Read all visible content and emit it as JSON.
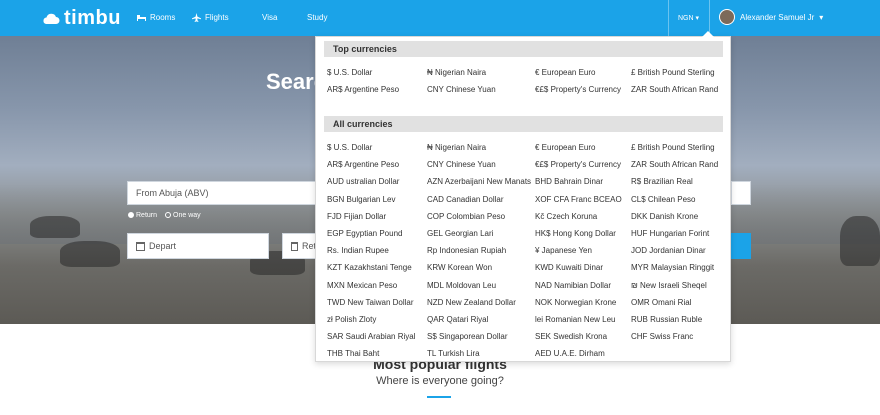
{
  "brand": {
    "name": "timbu"
  },
  "nav": {
    "rooms": "Rooms",
    "flights": "Flights",
    "visa": "Visa",
    "study": "Study",
    "currency": "NGN",
    "user": "Alexander Samuel Jr"
  },
  "hero": {
    "title": "Searc",
    "from_placeholder": "From Abuja (ABV)",
    "return_option": "Return",
    "oneway_option": "One way",
    "depart": "Depart",
    "return": "Retu"
  },
  "popular": {
    "title": "Most popular flights",
    "subtitle": "Where is everyone going?"
  },
  "dropdown": {
    "top_header": "Top currencies",
    "all_header": "All currencies",
    "top": [
      "$ U.S. Dollar",
      "₦ Nigerian Naira",
      "€ European Euro",
      "£ British Pound Sterling",
      "AR$ Argentine Peso",
      "CNY Chinese Yuan",
      "€£$ Property's Currency",
      "ZAR South African Rand"
    ],
    "all": [
      "$ U.S. Dollar",
      "₦ Nigerian Naira",
      "€ European Euro",
      "£ British Pound Sterling",
      "AR$ Argentine Peso",
      "CNY Chinese Yuan",
      "€£$ Property's Currency",
      "ZAR South African Rand",
      "AUD ustralian Dollar",
      "AZN Azerbaijani New Manats",
      "BHD Bahrain Dinar",
      "R$ Brazilian Real",
      "BGN Bulgarian Lev",
      "CAD Canadian Dollar",
      "XOF CFA Franc BCEAO",
      "CL$ Chilean Peso",
      "FJD Fijian Dollar",
      "COP Colombian Peso",
      "Kč Czech Koruna",
      "DKK Danish Krone",
      "EGP Egyptian Pound",
      "GEL Georgian Lari",
      "HK$ Hong Kong Dollar",
      "HUF Hungarian Forint",
      "Rs. Indian Rupee",
      "Rp Indonesian Rupiah",
      "¥ Japanese Yen",
      "JOD Jordanian Dinar",
      "KZT Kazakhstani Tenge",
      "KRW Korean Won",
      "KWD Kuwaiti Dinar",
      "MYR Malaysian Ringgit",
      "MXN Mexican Peso",
      "MDL Moldovan Leu",
      "NAD Namibian Dollar",
      "₪ New Israeli Sheqel",
      "TWD New Taiwan Dollar",
      "NZD New Zealand Dollar",
      "NOK Norwegian Krone",
      "OMR Omani Rial",
      "zł Polish Zloty",
      "QAR Qatari Riyal",
      "lei Romanian New Leu",
      "RUB Russian Ruble",
      "SAR Saudi Arabian Riyal",
      "S$ Singaporean Dollar",
      "SEK Swedish Krona",
      "CHF Swiss Franc",
      "THB Thai Baht",
      "TL Turkish Lira",
      "AED U.A.E. Dirham",
      ""
    ]
  },
  "colors": {
    "brand_blue": "#1ba3e8"
  },
  "icons": {
    "logo": "cloud-icon",
    "rooms": "bed-icon",
    "flights": "plane-icon",
    "calendar": "calendar-icon"
  }
}
